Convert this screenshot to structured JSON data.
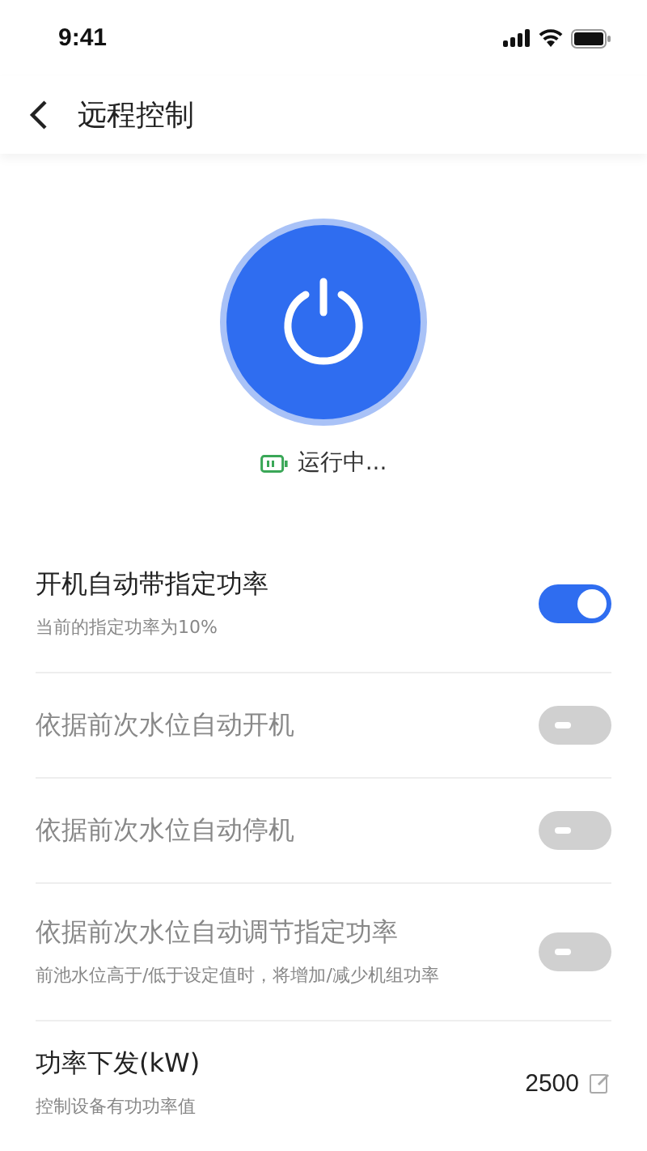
{
  "status_bar": {
    "time": "9:41"
  },
  "header": {
    "title": "远程控制"
  },
  "power": {
    "on": true,
    "status": "运行中..."
  },
  "settings": [
    {
      "kind": "toggle",
      "title": "开机自动带指定功率",
      "subtitle": "当前的指定功率为10%",
      "on": true,
      "disabled": false
    },
    {
      "kind": "toggle",
      "title": "依据前次水位自动开机",
      "on": false,
      "disabled": true
    },
    {
      "kind": "toggle",
      "title": "依据前次水位自动停机",
      "on": false,
      "disabled": true
    },
    {
      "kind": "toggle",
      "title": "依据前次水位自动调节指定功率",
      "subtitle": "前池水位高于/低于设定值时，将增加/减少机组功率",
      "on": false,
      "disabled": true
    },
    {
      "kind": "value",
      "title": "功率下发(kW)",
      "subtitle": "控制设备有功功率值",
      "value": "2500",
      "disabled": false
    }
  ]
}
